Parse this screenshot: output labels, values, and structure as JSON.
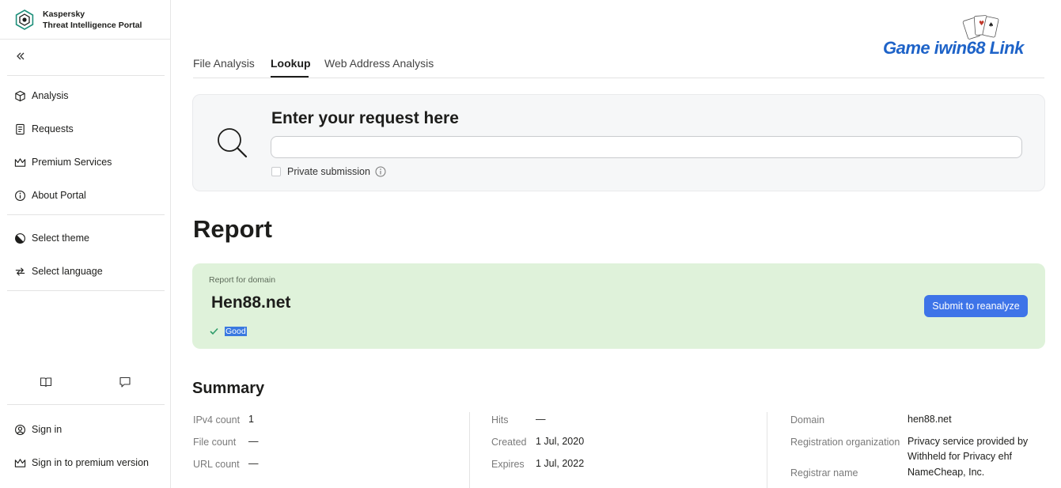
{
  "brand": {
    "line1": "Kaspersky",
    "line2": "Threat Intelligence Portal"
  },
  "sidebar": {
    "nav": [
      {
        "label": "Analysis",
        "icon": "cube-icon"
      },
      {
        "label": "Requests",
        "icon": "document-icon"
      },
      {
        "label": "Premium Services",
        "icon": "crown-icon"
      },
      {
        "label": "About Portal",
        "icon": "info-icon"
      }
    ],
    "settings": [
      {
        "label": "Select theme",
        "icon": "theme-icon"
      },
      {
        "label": "Select language",
        "icon": "language-icon"
      }
    ],
    "footer_icons": [
      "book-icon",
      "chat-icon"
    ],
    "account": [
      {
        "label": "Sign in",
        "icon": "user-icon"
      },
      {
        "label": "Sign in to premium version",
        "icon": "crown-icon"
      }
    ]
  },
  "tabs": [
    {
      "label": "File Analysis",
      "active": false
    },
    {
      "label": "Lookup",
      "active": true
    },
    {
      "label": "Web Address Analysis",
      "active": false
    }
  ],
  "search": {
    "title": "Enter your request here",
    "value": "",
    "placeholder": "",
    "private_label": "Private submission"
  },
  "report": {
    "title": "Report",
    "label": "Report for domain",
    "domain": "Hen88.net",
    "status": "Good",
    "reanalyze_label": "Submit to reanalyze"
  },
  "summary": {
    "title": "Summary",
    "col1": [
      {
        "label": "IPv4 count",
        "value": "1"
      },
      {
        "label": "File count",
        "value": "—"
      },
      {
        "label": "URL count",
        "value": "—"
      }
    ],
    "col2": [
      {
        "label": "Hits",
        "value": "—"
      },
      {
        "label": "Created",
        "value": "1 Jul, 2020"
      },
      {
        "label": "Expires",
        "value": "1 Jul, 2022"
      }
    ],
    "col3": [
      {
        "label": "Domain",
        "value": "hen88.net"
      },
      {
        "label": "Registration organization",
        "value": "Privacy service provided by Withheld for Privacy ehf"
      },
      {
        "label": "Registrar name",
        "value": "NameCheap, Inc."
      }
    ]
  },
  "watermark": {
    "text": "Game iwin68 Link"
  },
  "colors": {
    "accent": "#3e74e8",
    "good_bg": "#dff2da",
    "good_check": "#2e9c6a"
  }
}
